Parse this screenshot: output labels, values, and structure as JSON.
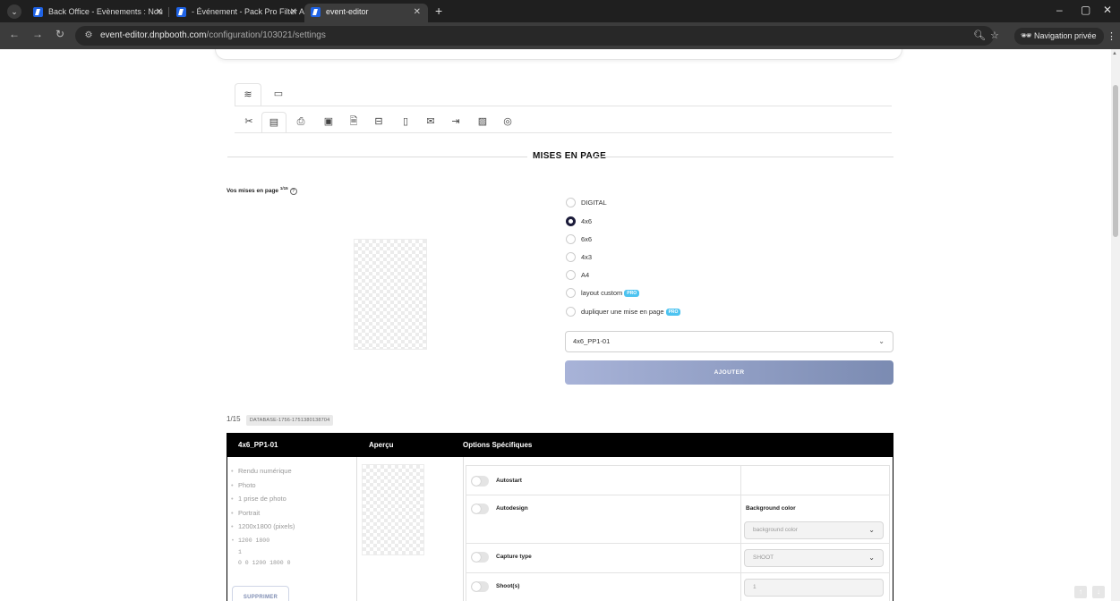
{
  "browser": {
    "tabs": [
      {
        "title": "Back Office - Evènements : Nou"
      },
      {
        "title": "- Événement - Pack Pro Filter A"
      },
      {
        "title": "event-editor"
      }
    ],
    "new_tab_icon": "plus-icon",
    "url_host": "event-editor.dnpbooth.com",
    "url_path": "/configuration/103021/settings",
    "private_label": "Navigation privée",
    "window_controls": [
      "minimize-icon",
      "restore-icon",
      "close-icon"
    ]
  },
  "settings": {
    "top_tabs": [
      "sliders-icon",
      "layout-icon"
    ],
    "icon_tabs": [
      "tools-icon",
      "document-icon",
      "printer-icon",
      "gallery-icon",
      "file-icon",
      "text-icon",
      "phone-icon",
      "chat-icon",
      "export-icon",
      "image-icon",
      "fingerprint-icon"
    ]
  },
  "layout_section": {
    "title": "MISES EN PAGE",
    "vos_label": "Vos mises en page",
    "vos_count": "1/15",
    "help_icon": "?",
    "options": [
      {
        "label": "DIGITAL",
        "checked": false,
        "pro": false
      },
      {
        "label": "4x6",
        "checked": true,
        "pro": false
      },
      {
        "label": "6x6",
        "checked": false,
        "pro": false
      },
      {
        "label": "4x3",
        "checked": false,
        "pro": false
      },
      {
        "label": "A4",
        "checked": false,
        "pro": false
      },
      {
        "label": "layout custom",
        "checked": false,
        "pro": true
      },
      {
        "label": "dupliquer une mise en page",
        "checked": false,
        "pro": true
      }
    ],
    "pro_badge": "PRO",
    "select_value": "4x6_PP1-01",
    "add_button": "AJOUTER"
  },
  "layout_list": {
    "counter": "1/15",
    "db_tag": "DATABASE-1756-1751380138704",
    "headers": {
      "name": "4x6_PP1-01",
      "preview": "Aperçu",
      "options": "Options Spécifiques"
    },
    "details": [
      "Rendu numérique",
      "Photo",
      "1 prise de photo",
      "Portrait",
      "1200x1800 (pixels)"
    ],
    "mono_lines": [
      "1200 1800",
      "1",
      "0 0 1200 1800 0"
    ],
    "delete_button": "SUPPRIMER",
    "options": [
      {
        "label": "Autostart"
      },
      {
        "label": "Autodesign",
        "field_label": "Background color",
        "field_value": "background color"
      },
      {
        "label": "Capture type",
        "field_value": "SHOOT"
      },
      {
        "label": "Shoot(s)",
        "field_value": "1"
      }
    ]
  },
  "colors": {
    "accent_button_start": "#a8b3d8",
    "accent_button_end": "#7b8bb2",
    "pro_badge": "#4dc3f0",
    "table_header": "#000000"
  }
}
